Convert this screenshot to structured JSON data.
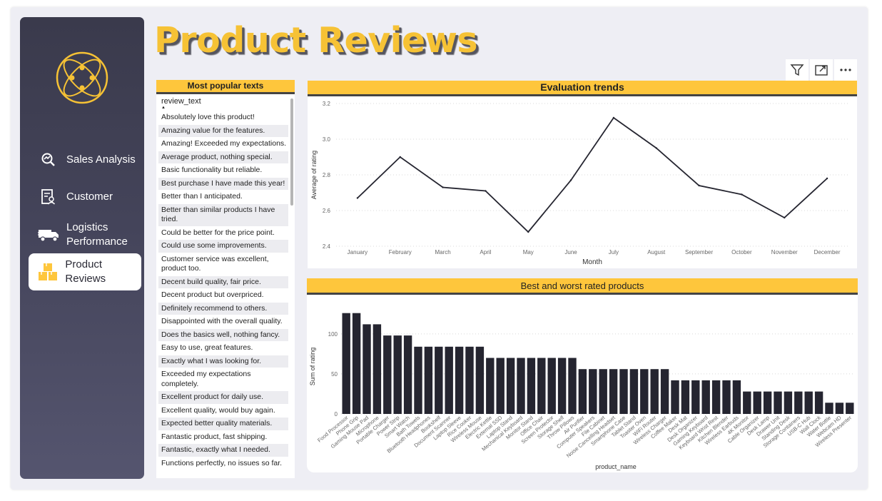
{
  "title": "Product Reviews",
  "colors": {
    "accent": "#fec63c",
    "sidebar": "#44445a",
    "bar": "#252530",
    "line": "#252530"
  },
  "nav": [
    {
      "label": "Sales Analysis",
      "icon": "chart-search-icon",
      "active": false
    },
    {
      "label": "Customer",
      "icon": "customer-card-icon",
      "active": false
    },
    {
      "label": "Logistics Performance",
      "icon": "truck-icon",
      "active": false
    },
    {
      "label": "Product Reviews",
      "icon": "boxes-icon",
      "active": true
    }
  ],
  "popular": {
    "title": "Most popular texts",
    "column": "review_text",
    "items": [
      "Absolutely love this product!",
      "Amazing value for the features.",
      "Amazing! Exceeded my expectations.",
      "Average product, nothing special.",
      "Basic functionality but reliable.",
      "Best purchase I have made this year!",
      "Better than I anticipated.",
      "Better than similar products I have tried.",
      "Could be better for the price point.",
      "Could use some improvements.",
      "Customer service was excellent, product too.",
      "Decent build quality, fair price.",
      "Decent product but overpriced.",
      "Definitely recommend to others.",
      "Disappointed with the overall quality.",
      "Does the basics well, nothing fancy.",
      "Easy to use, great features.",
      "Exactly what I was looking for.",
      "Exceeded my expectations completely.",
      "Excellent product for daily use.",
      "Excellent quality, would buy again.",
      "Expected better quality materials.",
      "Fantastic product, fast shipping.",
      "Fantastic, exactly what I needed.",
      "Functions perfectly, no issues so far."
    ]
  },
  "toolbar": {
    "filter": "filter-icon",
    "expand": "expand-icon",
    "more": "more-options-icon"
  },
  "chart_data": [
    {
      "type": "line",
      "title": "Evaluation trends",
      "xlabel": "Month",
      "ylabel": "Average of rating",
      "categories": [
        "January",
        "February",
        "March",
        "April",
        "May",
        "June",
        "July",
        "August",
        "September",
        "October",
        "November",
        "December"
      ],
      "values": [
        2.67,
        2.9,
        2.73,
        2.71,
        2.48,
        2.77,
        3.12,
        2.95,
        2.74,
        2.69,
        2.56,
        2.78
      ],
      "ylim": [
        2.4,
        3.2
      ],
      "yticks": [
        2.4,
        2.6,
        2.8,
        3.0,
        3.2
      ],
      "grid": true
    },
    {
      "type": "bar",
      "title": "Best and worst rated products",
      "xlabel": "product_name",
      "ylabel": "Sum of rating",
      "categories": [
        "Food Processor",
        "Phone Grip",
        "Gaming Mouse Pad",
        "Microphone",
        "Portable Charger",
        "Power Strip",
        "Smart Watch",
        "Bath Towels",
        "Bluetooth Headphones",
        "Bookshelf",
        "Document Scanner",
        "Laptop Sleeve",
        "Rice Cooker",
        "Wireless Mouse",
        "Electric Kettle",
        "External SSD",
        "Laptop Stand",
        "Mechanical Keyboard",
        "Monitor Stand",
        "Office Chair",
        "Screen Protector",
        "Storage Shelf",
        "Throw Pillows",
        "Air Purifier",
        "Computer Speakers",
        "File Cabinet",
        "Noise Cancelling Headset",
        "Smartphone Case",
        "Tablet Stand",
        "Toaster Oven",
        "WiFi Router",
        "Wireless Charger",
        "Coffee Maker",
        "Desk Mat",
        "Desk Organizer",
        "Gaming Keyboard",
        "Keyboard Wrist Rest",
        "Kitchen Blender",
        "Wireless Earbuds",
        "4K Monitor",
        "Cable Organizer",
        "Desk Lamp",
        "Drawer Unit",
        "Standing Desk",
        "Storage Containers",
        "USB-C Hub",
        "Wall Clock",
        "Water Bottle",
        "Webcam HD",
        "Wireless Presenter"
      ],
      "values": [
        126,
        126,
        112,
        112,
        98,
        98,
        98,
        84,
        84,
        84,
        84,
        84,
        84,
        84,
        70,
        70,
        70,
        70,
        70,
        70,
        70,
        70,
        70,
        56,
        56,
        56,
        56,
        56,
        56,
        56,
        56,
        56,
        42,
        42,
        42,
        42,
        42,
        42,
        42,
        28,
        28,
        28,
        28,
        28,
        28,
        28,
        28,
        14,
        14,
        14
      ],
      "ylim": [
        0,
        140
      ],
      "yticks": [
        0,
        50,
        100
      ],
      "grid": true
    }
  ]
}
